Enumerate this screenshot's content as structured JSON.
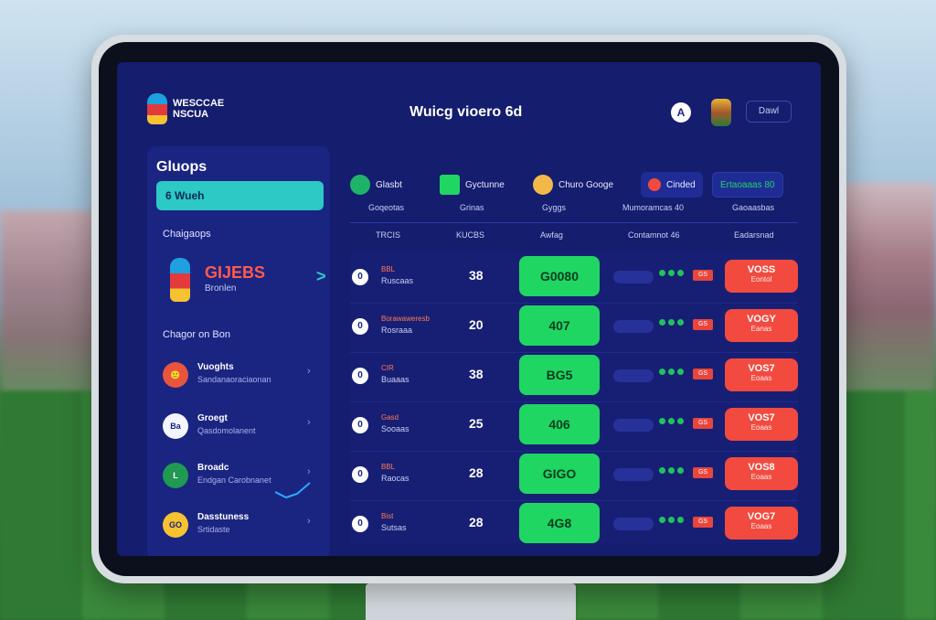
{
  "header": {
    "logo_line1": "WESCCAE",
    "logo_line2": "NSCUA",
    "title": "Wuicg vioero 6d",
    "avatar_text": "A",
    "button_label": "Dawl"
  },
  "sidebar": {
    "title": "Gluops",
    "active_item": "6 Wueh",
    "subheading1": "Chaigaops",
    "feature": {
      "title": "GIJEBS",
      "subtitle": "Bronlen"
    },
    "subheading2": "Chagor on Bon",
    "items": [
      {
        "avatar": "🙂",
        "title": "Vuoghts",
        "subtitle": "Sandanaoraciaonan",
        "avatar_color": "#e8553c"
      },
      {
        "avatar": "Ba",
        "title": "Groegt",
        "subtitle": "Qasdomolanent",
        "avatar_color": "#f3f5ff"
      },
      {
        "avatar": "L",
        "title": "Broadc",
        "subtitle": "Endgan Carobnanet",
        "avatar_color": "#1f9a50"
      },
      {
        "avatar": "GO",
        "title": "Dasstuness",
        "subtitle": "Srtidaste",
        "avatar_color": "#f6c231"
      }
    ]
  },
  "filters": [
    {
      "label": "Glasbt",
      "icon": "ball-icon",
      "color": "#1fb36a"
    },
    {
      "label": "Gyctunne",
      "icon": "flag-icon",
      "color": "#1fd663"
    },
    {
      "label": "Churo Googe",
      "icon": "trophy-icon",
      "color": "#f2b94a"
    },
    {
      "label": "Cinded",
      "icon": "record-icon",
      "color": "#f24a3f"
    },
    {
      "label": "Ertaoaaas 80",
      "icon": "",
      "color": "#1fd663"
    }
  ],
  "table": {
    "header_row1": [
      "Goqeotas",
      "Grinas",
      "Gyggs",
      "Mumoramcas 40",
      "Gaoaasbas"
    ],
    "header_row2": [
      "TRCIS",
      "KUCBS",
      "Awfag",
      "Contamnot 46",
      "Eadarsnad"
    ],
    "rows": [
      {
        "radio": "0",
        "name_top": "BBL",
        "name_bottom": "Ruscaas",
        "number": "38",
        "score": "G0080",
        "tag": "GS",
        "vote": "VOSS",
        "vote_sub": "Eontol"
      },
      {
        "radio": "0",
        "name_top": "Borawaweresb",
        "name_bottom": "Rosraaa",
        "number": "20",
        "score": "407",
        "tag": "GS",
        "vote": "VOGY",
        "vote_sub": "Eanas"
      },
      {
        "radio": "0",
        "name_top": "CIR",
        "name_bottom": "Buaaas",
        "number": "38",
        "score": "BG5",
        "tag": "GS",
        "vote": "VOS7",
        "vote_sub": "Eoaas"
      },
      {
        "radio": "0",
        "name_top": "Gasd",
        "name_bottom": "Sooaas",
        "number": "25",
        "score": "406",
        "tag": "GS",
        "vote": "VOS7",
        "vote_sub": "Eoaas"
      },
      {
        "radio": "0",
        "name_top": "BBL",
        "name_bottom": "Raocas",
        "number": "28",
        "score": "GIGO",
        "tag": "GS",
        "vote": "VOS8",
        "vote_sub": "Eoaas"
      },
      {
        "radio": "0",
        "name_top": "Bist",
        "name_bottom": "Sutsas",
        "number": "28",
        "score": "4G8",
        "tag": "GS",
        "vote": "VOG7",
        "vote_sub": "Eoaas"
      }
    ]
  }
}
